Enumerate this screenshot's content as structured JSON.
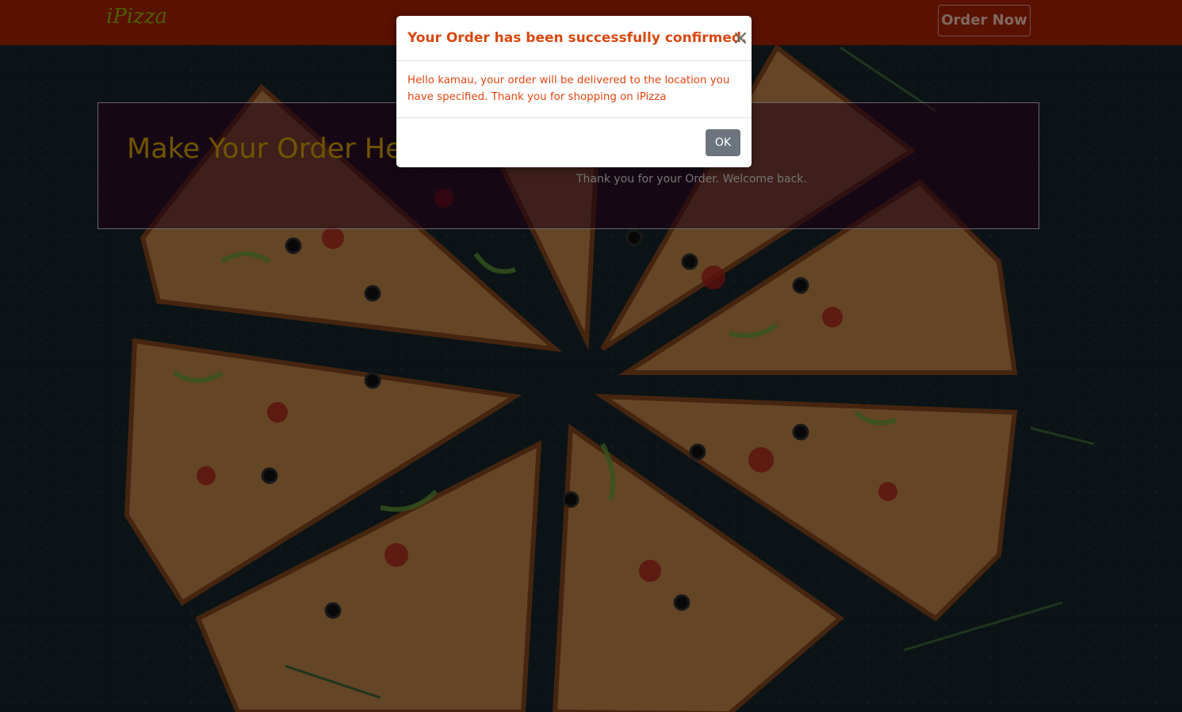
{
  "navbar": {
    "brand": "iPizza",
    "order_now_label": "Order Now"
  },
  "hero": {
    "title": "Make Your Order He",
    "thanks_text": "Thank you for your Order. Welcome back."
  },
  "modal": {
    "title": "Your Order has been successfully confirmed.",
    "close_symbol": "×",
    "body": "Hello kamau, your order will be delivered to the location you have specified. Thank you for shopping on iPizza",
    "ok_label": "OK"
  },
  "colors": {
    "navbar": "#b32200",
    "brand": "#9bbf00",
    "modal_title": "#d9480f",
    "ok_button": "#6c757d"
  }
}
